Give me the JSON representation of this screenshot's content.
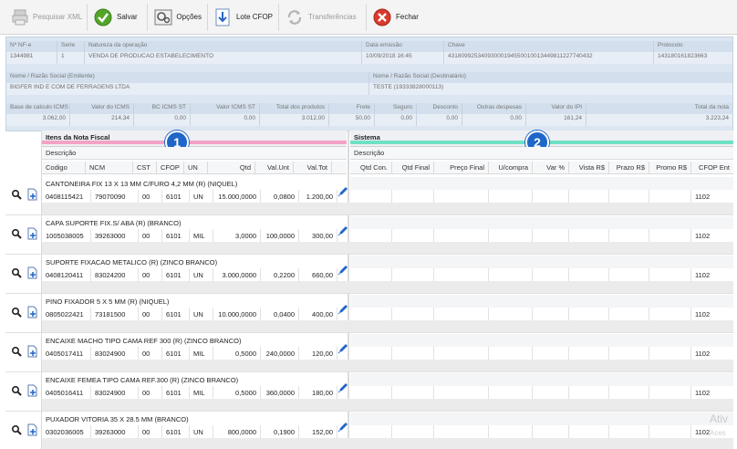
{
  "toolbar": {
    "buttons": [
      {
        "label": "Pesquisar XML",
        "icon": "printer-icon",
        "disabled": true
      },
      {
        "label": "Salvar",
        "icon": "check-circle-icon",
        "disabled": false
      },
      {
        "label": "Opções",
        "icon": "settings-icon",
        "disabled": false
      },
      {
        "label": "Lote CFOP",
        "icon": "download-arrow-icon",
        "disabled": false
      },
      {
        "label": "Transferências",
        "icon": "refresh-icon",
        "disabled": true
      },
      {
        "label": "Fechar",
        "icon": "close-circle-icon",
        "disabled": false
      }
    ]
  },
  "header": {
    "row1_labels": [
      "Nº NF-e",
      "Serie",
      "Natureza da operação",
      "Data emissão",
      "Chave",
      "Protocolo"
    ],
    "row1_values": [
      "1344981",
      "1",
      "VENDA DE PRODUCAO ESTABELECIMENTO",
      "10/09/2018 16:45",
      "43180992534093000194550010013449811227740432",
      "143180161823663"
    ],
    "row2_labels": [
      "Nome / Razão Social (Emitente)",
      "Nome / Razão Social (Destinatário)"
    ],
    "row2_values": [
      "BIGFER IND E COM DE FERRAGENS LTDA",
      "TESTE (19333828000113)"
    ],
    "totals_labels": [
      "Base de calculo ICMS",
      "Valor do ICMS",
      "BC ICMS ST",
      "Valor ICMS ST",
      "Total dos produtos",
      "Frete",
      "Seguro",
      "Desconto",
      "Outras despesas",
      "Valor do IPI",
      "Total da nota"
    ],
    "totals_values": [
      "3.062,00",
      "214,34",
      "0,00",
      "0,00",
      "3.012,00",
      "50,00",
      "0,00",
      "0,00",
      "0,00",
      "161,24",
      "3.223,24"
    ]
  },
  "left_section": {
    "title": "Itens da Nota Fiscal",
    "badge": "1",
    "desc_header": "Descrição",
    "columns": [
      "Codigo",
      "NCM",
      "CST",
      "CFOP",
      "UN",
      "Qtd",
      "Val.Unt",
      "Val.Tot"
    ]
  },
  "right_section": {
    "title": "Sistema",
    "badge": "2",
    "desc_header": "Descrição",
    "columns": [
      "Qtd Con.",
      "Qtd Final",
      "Preço Final",
      "U/compra",
      "Var %",
      "Vista R$",
      "Prazo R$",
      "Promo R$",
      "CFOP Ent"
    ]
  },
  "items": [
    {
      "desc": "CANTONEIRA FIX 13 X 13 MM C/FURO 4,2 MM (R) (NIQUEL)",
      "codigo": "0408115421",
      "ncm": "79070090",
      "cst": "00",
      "cfop": "6101",
      "un": "UN",
      "qtd": "15.000,0000",
      "val_unt": "0,0800",
      "val_tot": "1.200,00",
      "cfop_ent": "1102"
    },
    {
      "desc": "CAPA SUPORTE FIX.S/ ABA (R) (BRANCO)",
      "codigo": "1005038005",
      "ncm": "39263000",
      "cst": "00",
      "cfop": "6101",
      "un": "MIL",
      "qtd": "3,0000",
      "val_unt": "100,0000",
      "val_tot": "300,00",
      "cfop_ent": "1102"
    },
    {
      "desc": "SUPORTE FIXACAO METALICO (R) (ZINCO BRANCO)",
      "codigo": "0408120411",
      "ncm": "83024200",
      "cst": "00",
      "cfop": "6101",
      "un": "UN",
      "qtd": "3.000,0000",
      "val_unt": "0,2200",
      "val_tot": "660,00",
      "cfop_ent": "1102"
    },
    {
      "desc": "PINO FIXADOR 5 X 5 MM (R) (NIQUEL)",
      "codigo": "0805022421",
      "ncm": "73181500",
      "cst": "00",
      "cfop": "6101",
      "un": "UN",
      "qtd": "10.000,0000",
      "val_unt": "0,0400",
      "val_tot": "400,00",
      "cfop_ent": "1102"
    },
    {
      "desc": "ENCAIXE MACHO TIPO CAMA REF 300 (R) (ZINCO BRANCO)",
      "codigo": "0405017411",
      "ncm": "83024900",
      "cst": "00",
      "cfop": "6101",
      "un": "MIL",
      "qtd": "0,5000",
      "val_unt": "240,0000",
      "val_tot": "120,00",
      "cfop_ent": "1102"
    },
    {
      "desc": "ENCAIXE FEMEA TIPO CAMA REF.300 (R) (ZINCO BRANCO)",
      "codigo": "0405016411",
      "ncm": "83024900",
      "cst": "00",
      "cfop": "6101",
      "un": "MIL",
      "qtd": "0,5000",
      "val_unt": "360,0000",
      "val_tot": "180,00",
      "cfop_ent": "1102"
    },
    {
      "desc": "PUXADOR VITORIA 35 X 28.5 MM (BRANCO)",
      "codigo": "0302036005",
      "ncm": "39263000",
      "cst": "00",
      "cfop": "6101",
      "un": "UN",
      "qtd": "800,0000",
      "val_unt": "0,1900",
      "val_tot": "152,00",
      "cfop_ent": "1102"
    }
  ],
  "watermark": {
    "line1": "Ativ",
    "line2": "Aces"
  },
  "colors": {
    "accent_blue": "#1f66c9",
    "pink_stripe": "#f2a3c6",
    "green_stripe": "#6fe0c4",
    "header_panel": "#dbe6f2"
  }
}
